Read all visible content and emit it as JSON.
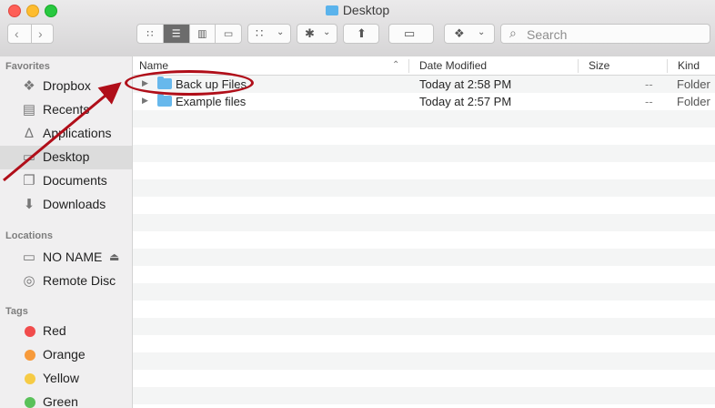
{
  "window": {
    "title": "Desktop"
  },
  "toolbar": {
    "back_icon": "chevron-left-icon",
    "forward_icon": "chevron-right-icon",
    "search_placeholder": "Search"
  },
  "sidebar": {
    "favorites_header": "Favorites",
    "favorites": [
      {
        "label": "Dropbox",
        "icon": "dropbox-icon"
      },
      {
        "label": "Recents",
        "icon": "recents-icon"
      },
      {
        "label": "Applications",
        "icon": "applications-icon"
      },
      {
        "label": "Desktop",
        "icon": "desktop-icon",
        "selected": true
      },
      {
        "label": "Documents",
        "icon": "documents-icon"
      },
      {
        "label": "Downloads",
        "icon": "downloads-icon"
      }
    ],
    "locations_header": "Locations",
    "locations": [
      {
        "label": "NO NAME",
        "icon": "drive-icon"
      },
      {
        "label": "Remote Disc",
        "icon": "disc-icon"
      }
    ],
    "tags_header": "Tags",
    "tags": [
      {
        "label": "Red",
        "color": "#f14c4c"
      },
      {
        "label": "Orange",
        "color": "#f79a3b"
      },
      {
        "label": "Yellow",
        "color": "#f6cb45"
      },
      {
        "label": "Green",
        "color": "#5ac15a"
      }
    ]
  },
  "list": {
    "columns": {
      "name": "Name",
      "date": "Date Modified",
      "size": "Size",
      "kind": "Kind"
    },
    "rows": [
      {
        "name": "Back up Files",
        "date": "Today at 2:58 PM",
        "size": "--",
        "kind": "Folder"
      },
      {
        "name": "Example files",
        "date": "Today at 2:57 PM",
        "size": "--",
        "kind": "Folder"
      }
    ]
  },
  "colors": {
    "annotation": "#b00e19",
    "folder": "#67b8ec",
    "selection": "#dcdcdc"
  }
}
